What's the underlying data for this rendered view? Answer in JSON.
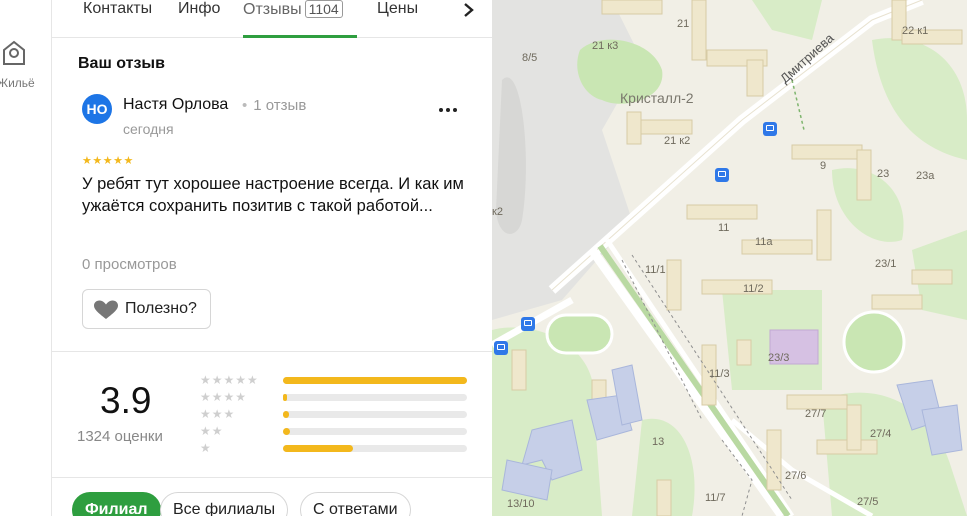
{
  "rail": {
    "icon": "housing-icon",
    "label": "Жильё"
  },
  "tabs": [
    {
      "label": "Контакты"
    },
    {
      "label": "Инфо"
    },
    {
      "label": "Отзывы",
      "count": "1104"
    },
    {
      "label": "Цены"
    }
  ],
  "review": {
    "section_title": "Ваш отзыв",
    "avatar_initials": "НО",
    "author": "Настя Орлова",
    "author_reviews": "1 отзыв",
    "date": "сегодня",
    "stars": "★★★★★",
    "text": "У ребят тут хорошее настроение всегда. И как им ужаётся сохранить позитив с такой работой...",
    "views": "0 просмотров",
    "helpful_label": "Полезно?"
  },
  "rating": {
    "value": "3.9",
    "count_label": "1324 оценки",
    "distribution": [
      {
        "stars": "★★★★★",
        "share": 1.0
      },
      {
        "stars": "★★★★",
        "share": 0.02
      },
      {
        "stars": "★★★",
        "share": 0.03
      },
      {
        "stars": "★★",
        "share": 0.04
      },
      {
        "stars": "★",
        "share": 0.38
      }
    ]
  },
  "filters": [
    {
      "label": "Филиал",
      "active": true
    },
    {
      "label": "Все филиалы",
      "active": false
    },
    {
      "label": "С ответами",
      "active": false
    }
  ],
  "map": {
    "street_name": "Дмитриева",
    "district": "Кристалл-2",
    "building_labels": [
      "21",
      "21 к3",
      "8/5",
      "21 к2",
      "22 к1",
      "9",
      "23",
      "23а",
      "11",
      "11а",
      "11/1",
      "11/2",
      "23/1",
      "23/3",
      "11/3",
      "27/7",
      "13",
      "27/4",
      "27/6",
      "11/7",
      "13/10",
      "27/5",
      "к2"
    ]
  },
  "colors": {
    "accent_green": "#2e9e3f",
    "star_yellow": "#f3b81c",
    "avatar_blue": "#1d75e6",
    "bus_stop_blue": "#2f78e8"
  }
}
